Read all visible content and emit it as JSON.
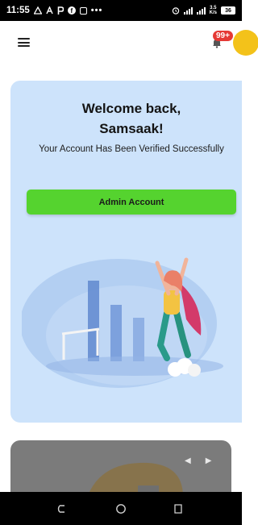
{
  "status_bar": {
    "time": "11:55",
    "left_icons": [
      "alert-triangle-icon",
      "plain-text-icon",
      "p-icon",
      "facebook-icon",
      "box-icon"
    ],
    "overflow_dots": "•••",
    "speed_value": "3.5",
    "speed_unit": "K/s",
    "battery_level": "36"
  },
  "header": {
    "notification_badge": "99+"
  },
  "welcome": {
    "title_line1": "Welcome back,",
    "title_line2": "Samsaak!",
    "subtitle": "Your Account Has Been Verified Successfully",
    "button_label": "Admin Account"
  },
  "colors": {
    "card_background": "#cde3fb",
    "button_green": "#55d32f",
    "badge_red": "#e53935",
    "avatar_yellow": "#f3c21a"
  }
}
